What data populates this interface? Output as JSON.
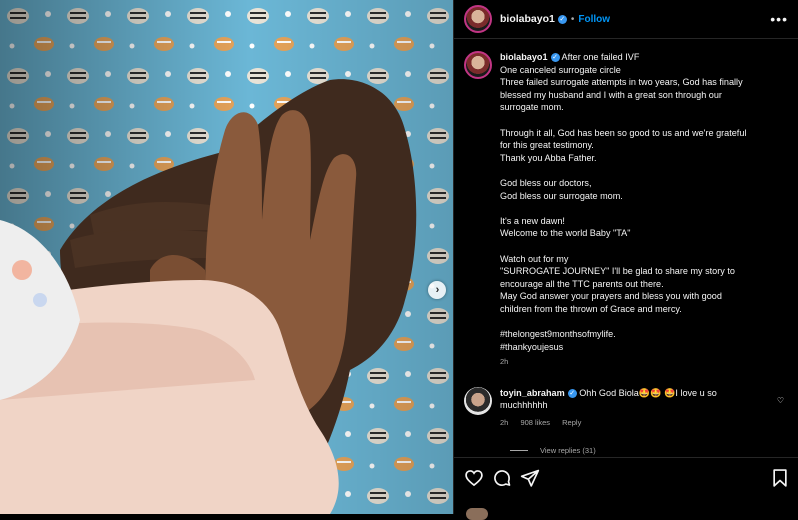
{
  "post": {
    "username": "biolabayo1",
    "follow_label": "Follow",
    "dot": "•",
    "more_icon": "more-horizontal-icon"
  },
  "caption": {
    "username": "biolabayo1",
    "lines": [
      "After one failed IVF",
      "One canceled surrogate circle",
      "Three failed surrogate attempts in two years, God has finally",
      "blessed my husband and I with a great son through our",
      "surrogate mom.",
      "",
      "Through it all, God has been so good to us and we're grateful",
      "for this great testimony.",
      "Thank you Abba Father.",
      "",
      "God bless our doctors,",
      "God bless our surrogate mom.",
      "",
      "It's a new dawn!",
      "Welcome to the world Baby \"TA\"",
      "",
      "Watch out for my",
      "\"SURROGATE JOURNEY\" I'll be glad to share my story to",
      "encourage all the TTC parents out there.",
      "May God answer your prayers and bless you with good",
      "children from the thrown of Grace and mercy.",
      "",
      "#thelongest9monthsofmylife.",
      "#thankyoujesus"
    ],
    "time": "2h"
  },
  "comment": {
    "username": "toyin_abraham",
    "text_line1": "Ohh God Biola🤩🤩 🤩I love u so",
    "text_line2": "muchhhhhh",
    "time": "2h",
    "likes": "908 likes",
    "reply_label": "Reply",
    "view_replies": "View replies (31)"
  },
  "actions": {
    "like_icon": "heart-icon",
    "comment_icon": "comment-icon",
    "share_icon": "send-icon",
    "save_icon": "bookmark-icon"
  },
  "media": {
    "next_icon": "chevron-right-icon"
  },
  "colors": {
    "accent": "#0095f6",
    "verified": "#3897f0",
    "background": "#000000",
    "muted": "#a8a8a8"
  }
}
